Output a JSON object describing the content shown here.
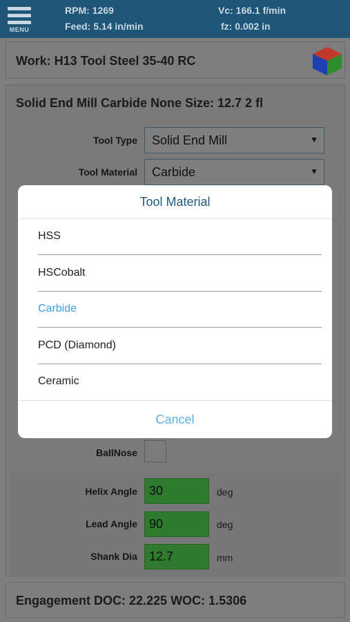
{
  "header": {
    "menu_label": "MENU",
    "rpm": "RPM: 1269",
    "feed": "Feed: 5.14 in/min",
    "vc": "Vc: 166.1 f/min",
    "fz": "fz: 0.002 in"
  },
  "work": {
    "title": "Work: H13 Tool Steel 35-40 RC",
    "cube_icon": "material-cube-icon",
    "cube_colors": [
      "#c0392b",
      "#1e3fb0",
      "#2e8b2e"
    ]
  },
  "tool": {
    "title": "Solid End Mill Carbide None Size: 12.7 2 fl",
    "tool_type_label": "Tool Type",
    "tool_type_value": "Solid End Mill",
    "tool_material_label": "Tool Material",
    "tool_material_value": "Carbide",
    "ballnose_label": "BallNose",
    "helix_label": "Helix Angle",
    "helix_value": "30",
    "helix_unit": "deg",
    "lead_label": "Lead Angle",
    "lead_value": "90",
    "lead_unit": "deg",
    "shank_label": "Shank Dia",
    "shank_value": "12.7",
    "shank_unit": "mm"
  },
  "engagement": {
    "title": "Engagement DOC: 22.225 WOC: 1.5306"
  },
  "dialog": {
    "title": "Tool Material",
    "options": [
      "HSS",
      "HSCobalt",
      "Carbide",
      "PCD (Diamond)",
      "Ceramic"
    ],
    "selected": "Carbide",
    "cancel_label": "Cancel"
  },
  "colors": {
    "header_bg": "#1f5577",
    "input_green": "#2f7a2f",
    "dialog_accent": "#3aa0d8"
  }
}
